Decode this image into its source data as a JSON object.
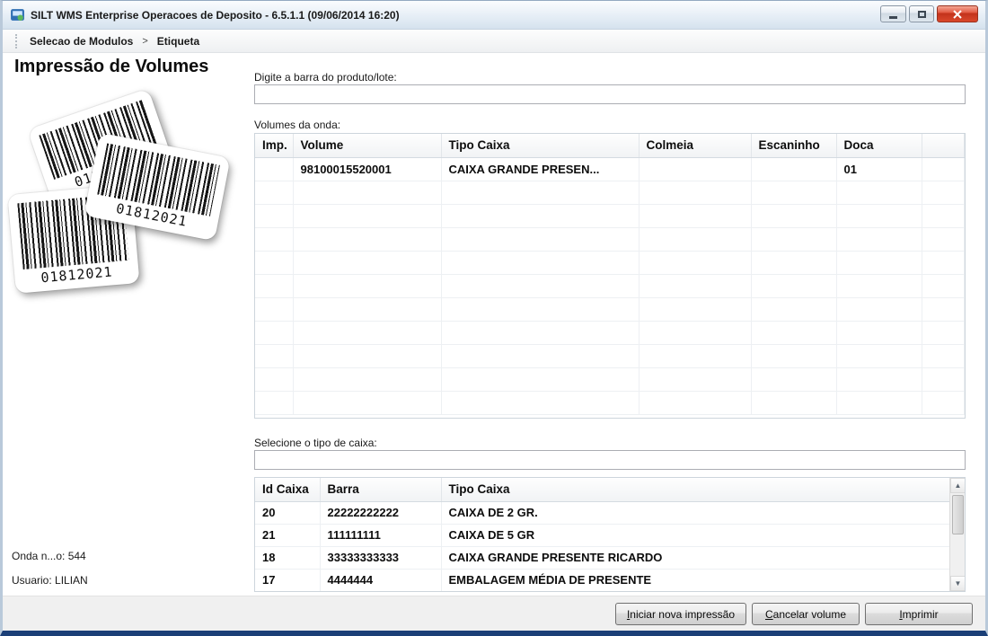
{
  "window": {
    "title": "SILT WMS Enterprise Operacoes de Deposito - 6.5.1.1 (09/06/2014 16:20)"
  },
  "breadcrumb": {
    "items": [
      "Selecao de Modulos",
      "Etiqueta"
    ],
    "separator": ">"
  },
  "main": {
    "heading": "Impressão de Volumes",
    "barcode_number": "01812021",
    "onda_label": "Onda n...o: 544",
    "usuario_label": "Usuario: LILIAN",
    "product_input": {
      "label": "Digite a barra do produto/lote:",
      "value": ""
    },
    "volumes_table": {
      "label": "Volumes da onda:",
      "columns": [
        "Imp.",
        "Volume",
        "Tipo Caixa",
        "Colmeia",
        "Escaninho",
        "Doca",
        ""
      ],
      "rows": [
        [
          "",
          "98100015520001",
          "CAIXA GRANDE PRESEN...",
          "",
          "",
          "01",
          ""
        ]
      ]
    },
    "caixa_select": {
      "label": "Selecione o tipo de caixa:",
      "value": ""
    },
    "caixa_table": {
      "columns": [
        "Id Caixa",
        "Barra",
        "Tipo Caixa"
      ],
      "rows": [
        [
          "20",
          "22222222222",
          "CAIXA DE 2 GR."
        ],
        [
          "21",
          "111111111",
          "CAIXA DE 5 GR"
        ],
        [
          "18",
          "33333333333",
          "CAIXA GRANDE PRESENTE RICARDO"
        ],
        [
          "17",
          "4444444",
          "EMBALAGEM MÉDIA DE PRESENTE"
        ]
      ]
    }
  },
  "footer": {
    "buttons": {
      "iniciar": "Iniciar nova impressão",
      "cancelar": "Cancelar volume",
      "imprimir": "Imprimir"
    }
  },
  "colors": {
    "close_button": "#c2321b",
    "window_border": "#b9c9da",
    "bottom_border": "#1b3f77"
  }
}
